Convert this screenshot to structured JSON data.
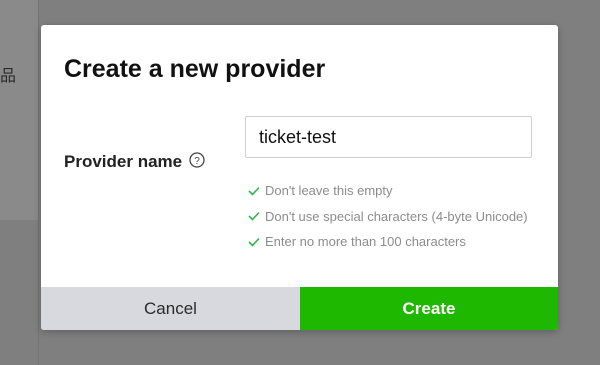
{
  "background": {
    "glyph": "品"
  },
  "dialog": {
    "title": "Create a new provider",
    "field": {
      "label": "Provider name",
      "help_icon": "question-circle-icon",
      "value": "ticket-test"
    },
    "validation": {
      "icon": "check-icon",
      "color": "#2db84a",
      "rules": [
        "Don't leave this empty",
        "Don't use special characters (4-byte Unicode)",
        "Enter no more than 100 characters"
      ]
    },
    "buttons": {
      "cancel": "Cancel",
      "create": "Create"
    }
  },
  "colors": {
    "overlay": "#7f7f7f",
    "primary": "#1fb800",
    "secondary": "#d7d9df"
  }
}
